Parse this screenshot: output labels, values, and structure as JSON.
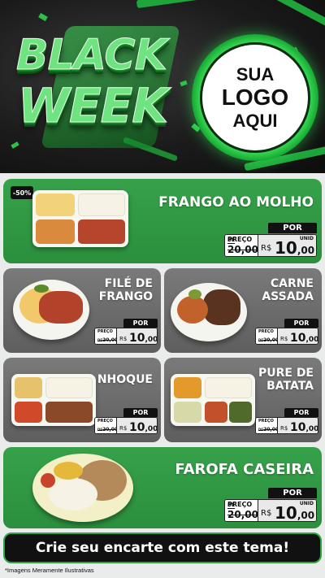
{
  "header": {
    "headline_line1": "BLACK",
    "headline_line2": "WEEK",
    "logo_placeholder": [
      "SUA",
      "LOGO",
      "AQUI"
    ]
  },
  "price_labels": {
    "por": "POR",
    "preco": "PREÇO",
    "de": "DE",
    "currency": "R$",
    "unit": "UNID"
  },
  "products": [
    {
      "name": "FRANGO AO MOLHO",
      "badge": "-50%",
      "old_price": "20,00",
      "price_int": "10",
      "price_cents": ",00"
    },
    {
      "name_lines": [
        "FILÉ DE",
        "FRANGO"
      ],
      "old_price": "20,00",
      "price_int": "10",
      "price_cents": ",00"
    },
    {
      "name_lines": [
        "CARNE",
        "ASSADA"
      ],
      "old_price": "20,00",
      "price_int": "10",
      "price_cents": ",00"
    },
    {
      "name": "NHOQUE",
      "old_price": "20,00",
      "price_int": "10",
      "price_cents": ",00"
    },
    {
      "name_lines": [
        "PURE DE",
        "BATATA"
      ],
      "old_price": "20,00",
      "price_int": "10",
      "price_cents": ",00"
    },
    {
      "name": "FAROFA CASEIRA",
      "old_price": "20,00",
      "price_int": "10",
      "price_cents": ",00"
    }
  ],
  "cta": "Crie seu encarte com este tema!",
  "disclaimer": "*Imagens Meramente Ilustrativas",
  "colors": {
    "green": "#2b8f3d",
    "gray": "#6a6a6a",
    "dark": "#111111",
    "neon_green": "#4df76a"
  }
}
